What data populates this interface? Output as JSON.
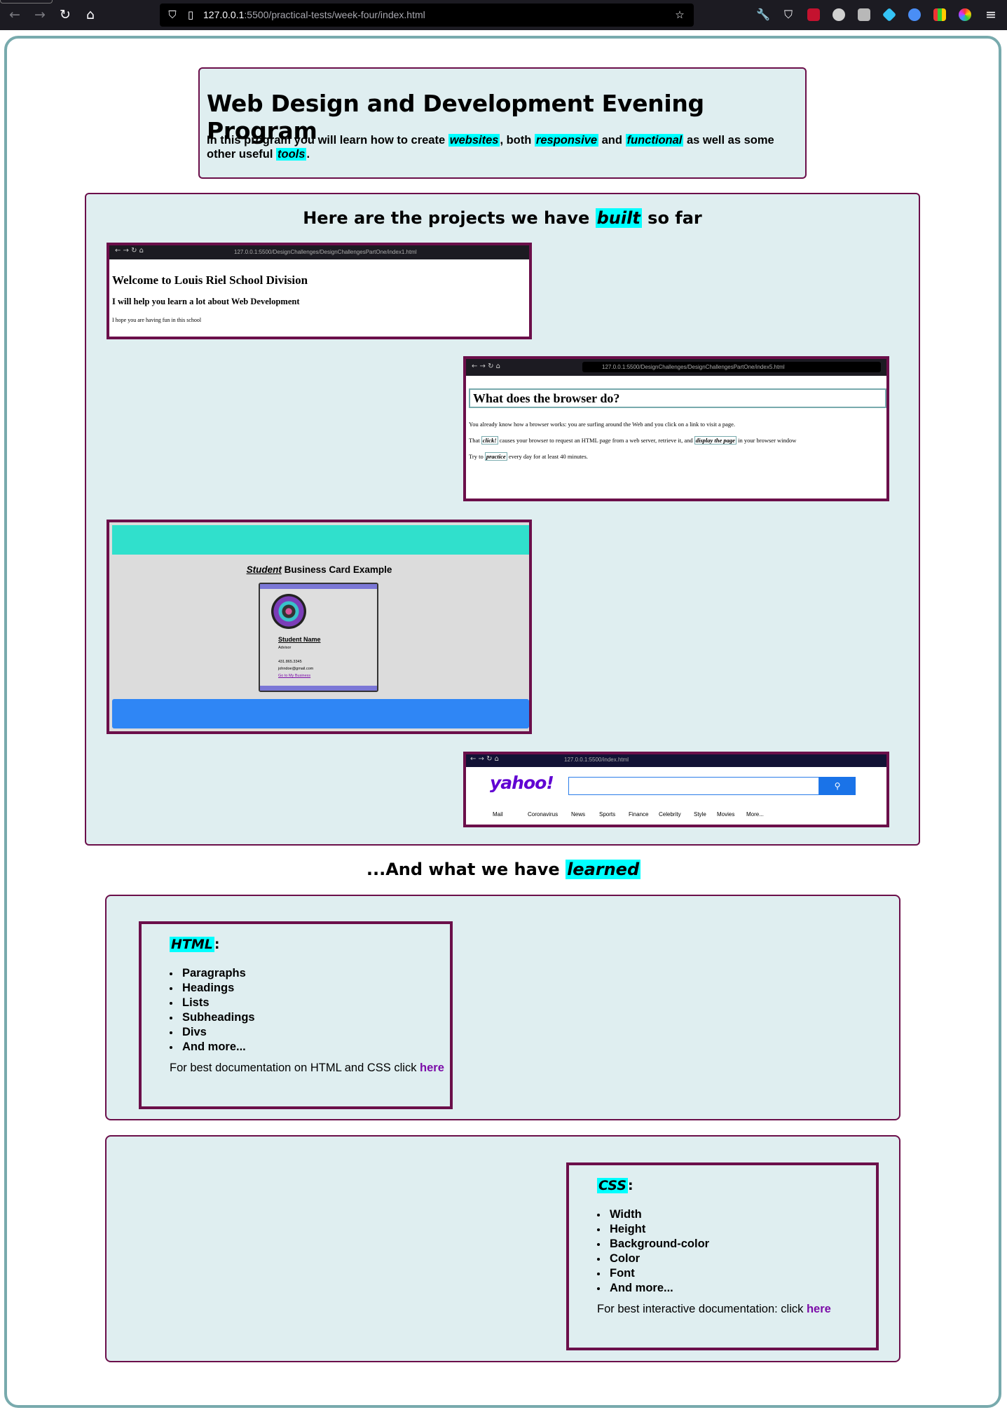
{
  "browser": {
    "url_host": "127.0.0.1",
    "url_path": ":5500/practical-tests/week-four/index.html"
  },
  "header": {
    "title": "Web Design and Development Evening Program",
    "intro_1": "In this program you will learn how to create ",
    "kw_websites": "websites",
    "intro_2": ", both ",
    "kw_responsive": "responsive",
    "intro_3": " and ",
    "kw_functional": "functional",
    "intro_4": " as well as some other useful ",
    "kw_tools": "tools",
    "intro_5": "."
  },
  "projects": {
    "heading_1": "Here are the projects we have ",
    "heading_kw": "built",
    "heading_2": " so far",
    "shot1": {
      "url": "127.0.0.1:5500/DesignChallenges/DesignChallengesPartOne/index1.html",
      "h1": "Welcome to Louis Riel School Division",
      "h3": "I will help you learn a lot about Web Development",
      "p": "I hope you are having fun in this school"
    },
    "shot2": {
      "url": "127.0.0.1:5500/DesignChallenges/DesignChallengesPartOne/index5.html",
      "h1": "What does the browser do?",
      "p1": "You already know how a browser works: you are surfing around the Web and you click on a link to visit a page.",
      "p2_a": "That ",
      "p2_click": "click!",
      "p2_b": " causes your browser to request an HTML page from a web server, retrieve it, and ",
      "p2_display": "display the page",
      "p2_c": " in your browser window",
      "p3_a": "Try to ",
      "p3_practice": "practice",
      "p3_b": " every day for at least 40 minutes."
    },
    "shot3": {
      "title_italic": "Student",
      "title_rest": " Business Card Example",
      "name": "Student Name",
      "role": "Advisor",
      "phone": "431.865.3345",
      "email": "johndoe@gmail.com",
      "link": "Go to My Business"
    },
    "shot4": {
      "url": "127.0.0.1:5500/index.html",
      "logo": "yahoo!",
      "nav": [
        "Mail",
        "Coronavirus",
        "News",
        "Sports",
        "Finance",
        "Celebrity",
        "Style",
        "Movies",
        "More..."
      ]
    }
  },
  "learned": {
    "heading_1": "...And what we have ",
    "heading_kw": "learned",
    "html": {
      "label": "HTML",
      "colon": ":",
      "items": [
        "Paragraphs",
        "Headings",
        "Lists",
        "Subheadings",
        "Divs",
        "And more..."
      ],
      "doc_text": "For best documentation on HTML and CSS click ",
      "doc_link": "here"
    },
    "css": {
      "label": "CSS",
      "colon": ":",
      "items": [
        "Width",
        "Height",
        "Background-color",
        "Color",
        "Font",
        "And more..."
      ],
      "doc_text": "For best interactive documentation: click ",
      "doc_link": "here"
    }
  },
  "colors": {
    "highlight": "#00ffff",
    "border": "#6b0f4a",
    "panel": "#dfeef0",
    "link": "#7b0ca8"
  },
  "icons": [
    "back-icon",
    "forward-icon",
    "reload-icon",
    "home-icon",
    "shield-icon",
    "page-icon",
    "star-icon",
    "wrench-icon",
    "pocket-icon",
    "menu-icon"
  ]
}
